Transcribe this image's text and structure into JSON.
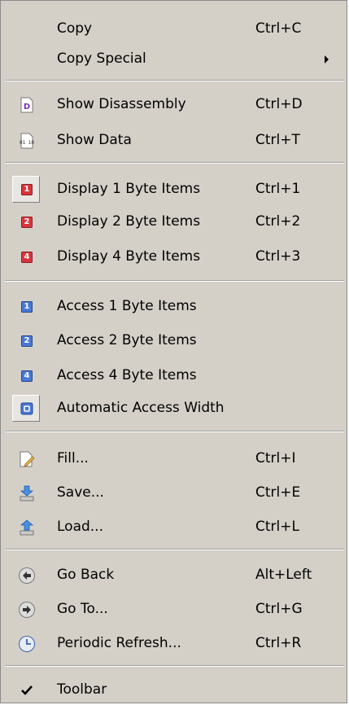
{
  "menu": {
    "items": [
      {
        "label": "Copy",
        "shortcut": "Ctrl+C"
      },
      {
        "label": "Copy Special",
        "submenu": true
      },
      {
        "label": "Show Disassembly",
        "shortcut": "Ctrl+D",
        "icon": "disassembly-icon"
      },
      {
        "label": "Show Data",
        "shortcut": "Ctrl+T",
        "icon": "data-icon"
      },
      {
        "label": "Display 1 Byte Items",
        "shortcut": "Ctrl+1",
        "icon": "display-1-byte-icon"
      },
      {
        "label": "Display 2 Byte Items",
        "shortcut": "Ctrl+2",
        "icon": "display-2-byte-icon"
      },
      {
        "label": "Display 4 Byte Items",
        "shortcut": "Ctrl+3",
        "icon": "display-4-byte-icon"
      },
      {
        "label": "Access 1 Byte Items",
        "icon": "access-1-byte-icon"
      },
      {
        "label": "Access 2 Byte Items",
        "icon": "access-2-byte-icon"
      },
      {
        "label": "Access 4 Byte Items",
        "icon": "access-4-byte-icon"
      },
      {
        "label": "Automatic Access Width",
        "icon": "auto-access-width-icon"
      },
      {
        "label": "Fill...",
        "shortcut": "Ctrl+I",
        "icon": "fill-icon"
      },
      {
        "label": "Save...",
        "shortcut": "Ctrl+E",
        "icon": "save-icon"
      },
      {
        "label": "Load...",
        "shortcut": "Ctrl+L",
        "icon": "load-icon"
      },
      {
        "label": "Go Back",
        "shortcut": "Alt+Left",
        "icon": "go-back-icon"
      },
      {
        "label": "Go To...",
        "shortcut": "Ctrl+G",
        "icon": "go-to-icon"
      },
      {
        "label": "Periodic Refresh...",
        "shortcut": "Ctrl+R",
        "icon": "periodic-refresh-icon"
      },
      {
        "label": "Toolbar",
        "icon": "checkmark-icon",
        "checked": true
      }
    ]
  },
  "icon_glyphs": {
    "disassembly": "D",
    "data": "01 10",
    "byte1": "1",
    "byte2": "2",
    "byte4": "4"
  },
  "colors": {
    "menu_bg": "#d4d0c8",
    "display_icons": "#d9353d",
    "access_icons": "#4a78d6"
  }
}
